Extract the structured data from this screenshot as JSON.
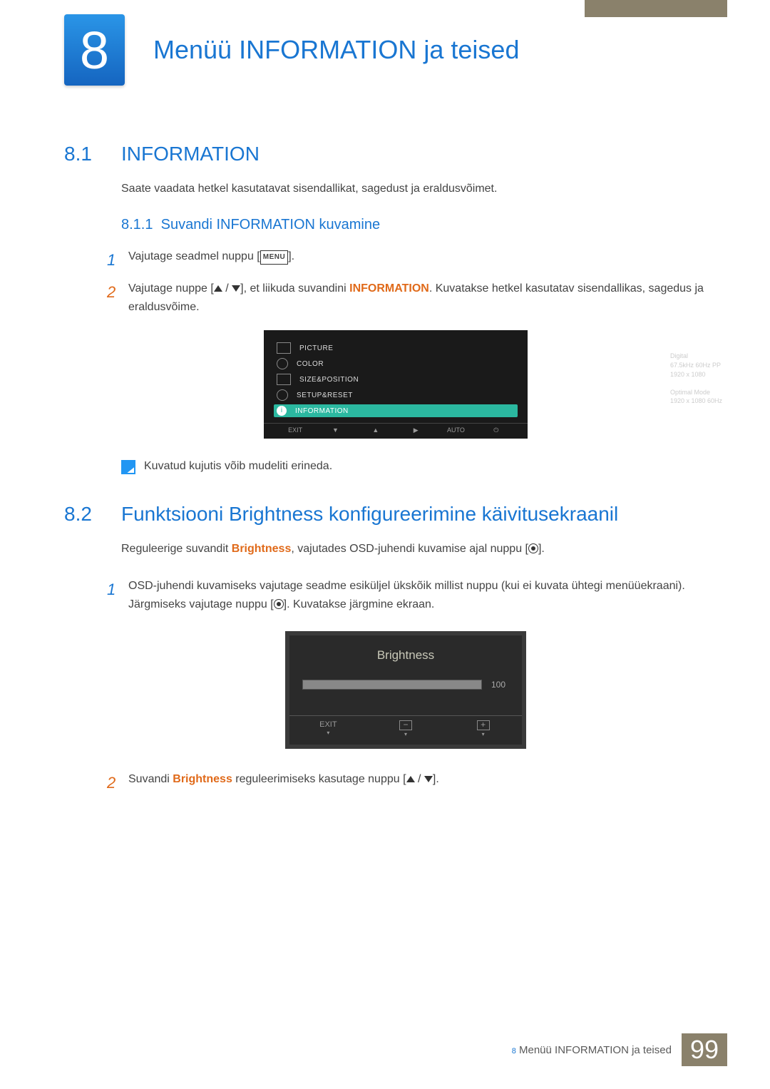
{
  "chapter": {
    "number": "8",
    "title": "Menüü INFORMATION ja teised"
  },
  "section81": {
    "num": "8.1",
    "title": "INFORMATION",
    "intro": "Saate vaadata hetkel kasutatavat sisendallikat, sagedust ja eraldusvõimet.",
    "subsec": {
      "num": "8.1.1",
      "title": "Suvandi INFORMATION kuvamine"
    },
    "step1_pre": "Vajutage seadmel nuppu [",
    "step1_post": "].",
    "step2_pre": "Vajutage nuppe [",
    "step2_mid": "], et liikuda suvandini ",
    "step2_keyword": "INFORMATION",
    "step2_post": ". Kuvatakse hetkel kasutatav sisendallikas, sagedus ja eraldusvõime.",
    "note": "Kuvatud kujutis võib mudeliti erineda."
  },
  "osd": {
    "items": [
      "PICTURE",
      "COLOR",
      "SIZE&POSITION",
      "SETUP&RESET",
      "INFORMATION"
    ],
    "info_lines": [
      "Digital",
      "67.5kHz 60Hz PP",
      "1920 x 1080",
      "",
      "Optimal Mode",
      "1920 x 1080 60Hz"
    ],
    "bottom": [
      "EXIT",
      "▼",
      "▲",
      "▶",
      "AUTO",
      "⏻"
    ]
  },
  "section82": {
    "num": "8.2",
    "title": "Funktsiooni Brightness konfigureerimine käivitusekraanil",
    "intro_pre": "Reguleerige suvandit ",
    "intro_kw": "Brightness",
    "intro_mid": ", vajutades OSD-juhendi kuvamise ajal nuppu [",
    "intro_post": "].",
    "step1": "OSD-juhendi kuvamiseks vajutage seadme esiküljel ükskõik millist nuppu (kui ei kuvata ühtegi menüüekraani). Järgmiseks vajutage nuppu [",
    "step1_post": "]. Kuvatakse järgmine ekraan.",
    "step2_pre": "Suvandi ",
    "step2_kw": "Brightness",
    "step2_mid": " reguleerimiseks kasutage nuppu [",
    "step2_post": "]."
  },
  "brightness_osd": {
    "title": "Brightness",
    "value": "100",
    "exit": "EXIT"
  },
  "footer": {
    "prefix": "8",
    "text": "Menüü INFORMATION ja teised",
    "page": "99"
  },
  "menu_label": "MENU"
}
